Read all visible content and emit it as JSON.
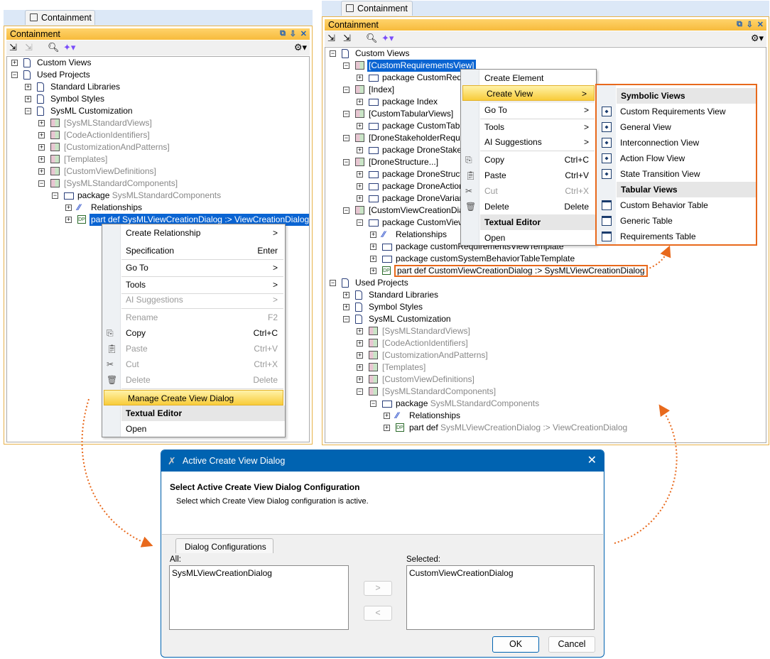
{
  "left_panel": {
    "tab_label": "Containment",
    "header_title": "Containment",
    "tree": [
      {
        "level": 0,
        "exp": "+",
        "icon": "doc",
        "label": "Custom Views"
      },
      {
        "level": 0,
        "exp": "-",
        "icon": "doc",
        "label": "Used Projects"
      },
      {
        "level": 1,
        "exp": "+",
        "icon": "doc",
        "label": "Standard Libraries"
      },
      {
        "level": 1,
        "exp": "+",
        "icon": "doc",
        "label": "Symbol Styles"
      },
      {
        "level": 1,
        "exp": "-",
        "icon": "doc",
        "label": "SysML Customization"
      },
      {
        "level": 2,
        "exp": "+",
        "icon": "lib",
        "label": "[SysMLStandardViews]",
        "grey": true
      },
      {
        "level": 2,
        "exp": "+",
        "icon": "lib",
        "label": "[CodeActionIdentifiers]",
        "grey": true
      },
      {
        "level": 2,
        "exp": "+",
        "icon": "lib",
        "label": "[CustomizationAndPatterns]",
        "grey": true
      },
      {
        "level": 2,
        "exp": "+",
        "icon": "lib",
        "label": "[Templates]",
        "grey": true
      },
      {
        "level": 2,
        "exp": "+",
        "icon": "lib",
        "label": "[CustomViewDefinitions]",
        "grey": true
      },
      {
        "level": 2,
        "exp": "-",
        "icon": "lib",
        "label": "[SysMLStandardComponents]",
        "grey": true
      },
      {
        "level": 3,
        "exp": "-",
        "icon": "pkg",
        "prefix": "package",
        "label": "SysMLStandardComponents",
        "grey": true
      },
      {
        "level": 4,
        "exp": "+",
        "icon": "rel",
        "label": "Relationships"
      },
      {
        "level": 4,
        "exp": "+",
        "icon": "part",
        "label": "part def SysMLViewCreationDialog :> ViewCreationDialog",
        "selected": true
      }
    ],
    "context_menu": [
      {
        "label": "Create Relationship",
        "shortcut": ">"
      },
      {
        "label": "Specification",
        "shortcut": "Enter"
      },
      {
        "label": "Go To",
        "shortcut": ">"
      },
      {
        "label": "Tools",
        "shortcut": ">"
      },
      {
        "label": "AI Suggestions",
        "shortcut": ">",
        "disabled": true
      },
      {
        "label": "Rename",
        "shortcut": "F2",
        "disabled": true
      },
      {
        "label": "Copy",
        "shortcut": "Ctrl+C",
        "icon": "copy"
      },
      {
        "label": "Paste",
        "shortcut": "Ctrl+V",
        "icon": "paste",
        "disabled": true
      },
      {
        "label": "Cut",
        "shortcut": "Ctrl+X",
        "icon": "cut",
        "disabled": true
      },
      {
        "label": "Delete",
        "shortcut": "Delete",
        "icon": "delete",
        "disabled": true
      },
      {
        "label": "Manage Create View Dialog",
        "highlight": true
      },
      {
        "label": "Textual Editor",
        "bold": true
      },
      {
        "label": "Open"
      }
    ]
  },
  "right_panel": {
    "tab_label": "Containment",
    "header_title": "Containment",
    "tree": [
      {
        "level": 0,
        "exp": "-",
        "icon": "doc",
        "label": "Custom Views"
      },
      {
        "level": 1,
        "exp": "-",
        "icon": "lib",
        "label": "[CustomRequirementsView]",
        "selected": true
      },
      {
        "level": 2,
        "exp": "+",
        "icon": "pkg",
        "label": "package CustomRequ"
      },
      {
        "level": 1,
        "exp": "-",
        "icon": "lib",
        "label": "[Index]"
      },
      {
        "level": 2,
        "exp": "+",
        "icon": "pkg",
        "label": "package Index"
      },
      {
        "level": 1,
        "exp": "-",
        "icon": "lib",
        "label": "[CustomTabularViews]"
      },
      {
        "level": 2,
        "exp": "+",
        "icon": "pkg",
        "label": "package CustomTabu"
      },
      {
        "level": 1,
        "exp": "-",
        "icon": "lib",
        "label": "[DroneStakeholderRequir"
      },
      {
        "level": 2,
        "exp": "+",
        "icon": "pkg",
        "label": "package DroneStakeh"
      },
      {
        "level": 1,
        "exp": "-",
        "icon": "lib",
        "label": "[DroneStructure...]"
      },
      {
        "level": 2,
        "exp": "+",
        "icon": "pkg",
        "label": "package DroneStructu"
      },
      {
        "level": 2,
        "exp": "+",
        "icon": "pkg",
        "label": "package DroneAction"
      },
      {
        "level": 2,
        "exp": "+",
        "icon": "pkg",
        "label": "package DroneVariant"
      },
      {
        "level": 1,
        "exp": "-",
        "icon": "lib",
        "label": "[CustomViewCreationDia"
      },
      {
        "level": 2,
        "exp": "-",
        "icon": "pkg",
        "label": "package CustomView"
      },
      {
        "level": 3,
        "exp": "+",
        "icon": "rel",
        "label": "Relationships"
      },
      {
        "level": 3,
        "exp": "+",
        "icon": "pkg",
        "label": "package customRequirementsViewTemplate"
      },
      {
        "level": 3,
        "exp": "+",
        "icon": "pkg",
        "label": "package customSystemBehaviorTableTemplate"
      },
      {
        "level": 3,
        "exp": "+",
        "icon": "part",
        "label": "part def CustomViewCreationDialog :> SysMLViewCreationDialog",
        "boxed": true
      },
      {
        "level": 0,
        "exp": "-",
        "icon": "doc",
        "label": "Used Projects"
      },
      {
        "level": 1,
        "exp": "+",
        "icon": "doc",
        "label": "Standard Libraries"
      },
      {
        "level": 1,
        "exp": "+",
        "icon": "doc",
        "label": "Symbol Styles"
      },
      {
        "level": 1,
        "exp": "-",
        "icon": "doc",
        "label": "SysML Customization"
      },
      {
        "level": 2,
        "exp": "+",
        "icon": "lib",
        "label": "[SysMLStandardViews]",
        "grey": true
      },
      {
        "level": 2,
        "exp": "+",
        "icon": "lib",
        "label": "[CodeActionIdentifiers]",
        "grey": true
      },
      {
        "level": 2,
        "exp": "+",
        "icon": "lib",
        "label": "[CustomizationAndPatterns]",
        "grey": true
      },
      {
        "level": 2,
        "exp": "+",
        "icon": "lib",
        "label": "[Templates]",
        "grey": true
      },
      {
        "level": 2,
        "exp": "+",
        "icon": "lib",
        "label": "[CustomViewDefinitions]",
        "grey": true
      },
      {
        "level": 2,
        "exp": "-",
        "icon": "lib",
        "label": "[SysMLStandardComponents]",
        "grey": true
      },
      {
        "level": 3,
        "exp": "-",
        "icon": "pkg",
        "prefix": "package",
        "label": "SysMLStandardComponents",
        "grey": true
      },
      {
        "level": 4,
        "exp": "+",
        "icon": "rel",
        "label": "Relationships"
      },
      {
        "level": 4,
        "exp": "+",
        "icon": "part",
        "prefix": "part def",
        "label": "SysMLViewCreationDialog :> ViewCreationDialog",
        "grey": true
      }
    ],
    "context_menu": [
      {
        "label": "Create Element"
      },
      {
        "label": "Create View",
        "shortcut": ">",
        "highlight": true
      },
      {
        "label": "Go To",
        "shortcut": ">"
      },
      {
        "label": "Tools",
        "shortcut": ">"
      },
      {
        "label": "AI Suggestions",
        "shortcut": ">"
      },
      {
        "label": "Copy",
        "shortcut": "Ctrl+C",
        "icon": "copy"
      },
      {
        "label": "Paste",
        "shortcut": "Ctrl+V",
        "icon": "paste"
      },
      {
        "label": "Cut",
        "shortcut": "Ctrl+X",
        "icon": "cut",
        "disabled": true
      },
      {
        "label": "Delete",
        "shortcut": "Delete",
        "icon": "delete"
      },
      {
        "label": "Textual Editor",
        "bold": true
      },
      {
        "label": "Open"
      }
    ],
    "submenu": [
      {
        "label": "Symbolic Views",
        "header": true
      },
      {
        "label": "Custom Requirements View",
        "icon": "diagram"
      },
      {
        "label": "General View",
        "icon": "diagram"
      },
      {
        "label": "Interconnection View",
        "icon": "diagram"
      },
      {
        "label": "Action Flow View",
        "icon": "diagram"
      },
      {
        "label": "State Transition View",
        "icon": "diagram"
      },
      {
        "label": "Tabular Views",
        "header": true
      },
      {
        "label": "Custom Behavior Table",
        "icon": "table"
      },
      {
        "label": "Generic Table",
        "icon": "table"
      },
      {
        "label": "Requirements Table",
        "icon": "table"
      }
    ]
  },
  "dialog": {
    "title": "Active Create View Dialog",
    "heading": "Select Active Create View Dialog Configuration",
    "description": "Select which Create View Dialog configuration is active.",
    "tab": "Dialog Configurations",
    "all_label": "All:",
    "all_items": [
      "SysMLViewCreationDialog"
    ],
    "selected_label": "Selected:",
    "selected_items": [
      "CustomViewCreationDialog"
    ],
    "add_button": ">",
    "remove_button": "<",
    "ok": "OK",
    "cancel": "Cancel"
  },
  "colors": {
    "accent": "#e8691c",
    "selection": "#0a64d2",
    "title_bar": "#0063b1"
  }
}
